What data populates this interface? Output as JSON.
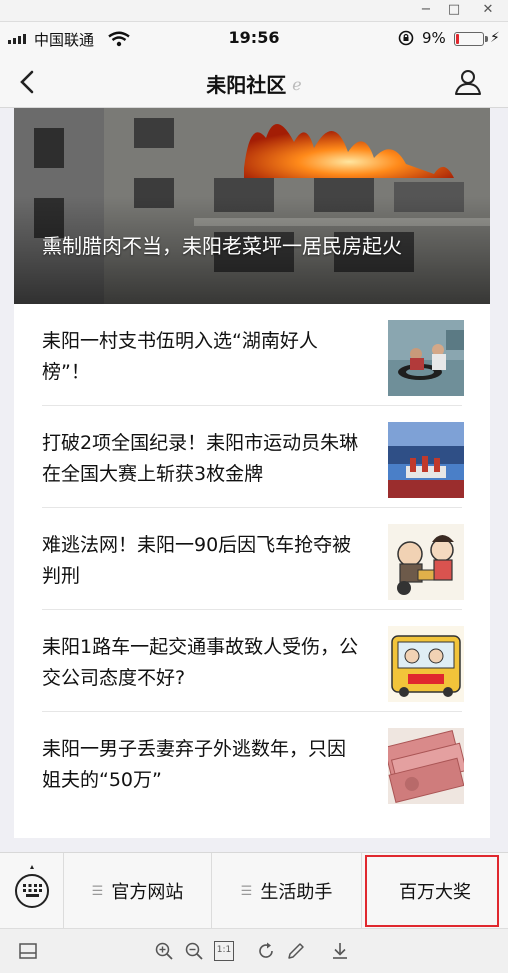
{
  "window": {
    "minimize_glyph": "−",
    "maximize_glyph": "□",
    "close_glyph": "✕"
  },
  "status": {
    "carrier": "中国联通",
    "time": "19:56",
    "battery_pct": "9%",
    "battery_level": 0.09,
    "battery_color": "#e0282e"
  },
  "nav": {
    "title": "耒阳社区",
    "back_icon": "chevron-left-icon",
    "title_icon": "ear-icon",
    "profile_icon": "user-icon"
  },
  "hero": {
    "title": "熏制腊肉不当，耒阳老菜坪一居民房起火",
    "image": "building-fire-photo"
  },
  "articles": [
    {
      "title": "耒阳一村支书伍明入选“湖南好人榜”！",
      "image": "flood-rescue-photo"
    },
    {
      "title": "打破2项全国纪录！耒阳市运动员朱琳在全国大赛上斩获3枚金牌",
      "image": "stadium-award-photo"
    },
    {
      "title": "难逃法网！耒阳一90后因飞车抢夺被判刑",
      "image": "cartoon-robbery-illustration"
    },
    {
      "title": "耒阳1路车一起交通事故致人受伤，公交公司态度不好?",
      "image": "cartoon-bus-illustration"
    },
    {
      "title": "耒阳一男子丢妻弃子外逃数年，只因姐夫的“50万”",
      "image": "cash-banknotes-photo"
    }
  ],
  "menu": {
    "keyboard_icon": "keyboard-icon",
    "items": [
      {
        "label": "官方网站",
        "has_submenu": true
      },
      {
        "label": "生活助手",
        "has_submenu": true
      },
      {
        "label": "百万大奖",
        "has_submenu": false
      }
    ],
    "highlight_color": "#e0282e"
  },
  "viewer_toolbar": {
    "buttons": [
      "panel-icon",
      "zoom-in-icon",
      "zoom-out-icon",
      "actual-size-icon",
      "rotate-icon",
      "edit-icon",
      "download-icon"
    ],
    "actual_size_label": "1:1"
  }
}
